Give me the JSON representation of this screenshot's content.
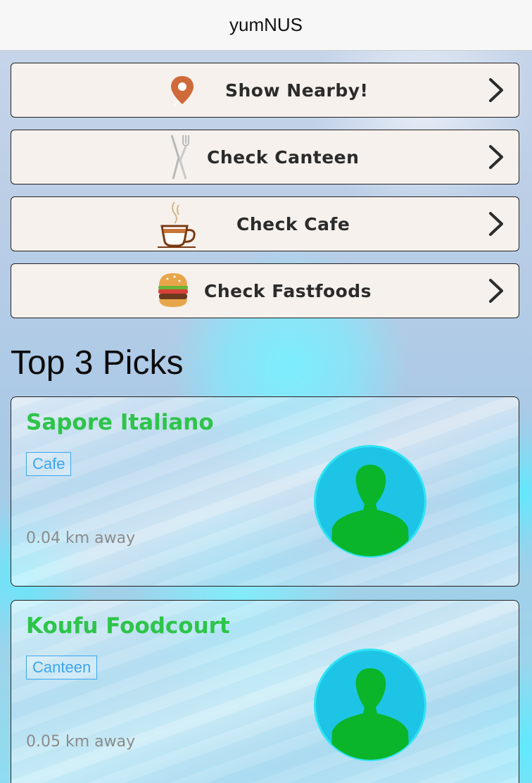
{
  "navbar": {
    "title": "yumNUS"
  },
  "menu": [
    {
      "label": "Show Nearby!",
      "icon": "location-pin-icon"
    },
    {
      "label": "Check Canteen",
      "icon": "fork-knife-icon"
    },
    {
      "label": "Check Cafe",
      "icon": "coffee-cup-icon"
    },
    {
      "label": "Check Fastfoods",
      "icon": "burger-icon"
    }
  ],
  "section": {
    "title": "Top 3 Picks"
  },
  "picks": [
    {
      "name": "Sapore Italiano",
      "category": "Cafe",
      "distance": "0.04 km away"
    },
    {
      "name": "Koufu Foodcourt",
      "category": "Canteen",
      "distance": "0.05 km away"
    }
  ],
  "colors": {
    "accent_green": "#2ec44a",
    "tag_blue": "#3aa6ef",
    "avatar_ring": "#2fe4f4",
    "avatar_fill": "#1ec4e6",
    "avatar_person": "#0ab52a"
  }
}
